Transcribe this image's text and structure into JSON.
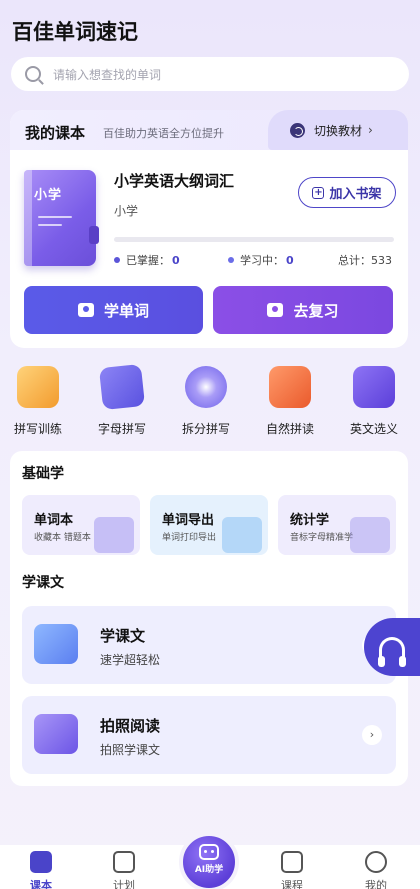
{
  "app": {
    "title": "百佳单词速记"
  },
  "search": {
    "placeholder": "请输入想查找的单词"
  },
  "course": {
    "header_title": "我的课本",
    "header_subtitle": "百佳助力英语全方位提升",
    "switch_label": "切换教材",
    "book_cover_label": "小学",
    "book_title": "小学英语大纲词汇",
    "book_subtitle": "小学",
    "add_shelf_label": "加入书架",
    "progress": 0,
    "mastered_label": "已掌握：",
    "mastered_value": "0",
    "learning_label": "学习中：",
    "learning_value": "0",
    "total_label": "总计：",
    "total_value": "533",
    "learn_button": "学单词",
    "review_button": "去复习"
  },
  "features": [
    {
      "label": "拼写训练",
      "icon": "headphones-icon",
      "color": "#f2a33a"
    },
    {
      "label": "字母拼写",
      "icon": "cards-icon",
      "color": "#6a63e8"
    },
    {
      "label": "拆分拼写",
      "icon": "microphone-icon",
      "color": "#7b6ef0"
    },
    {
      "label": "自然拼读",
      "icon": "radio-icon",
      "color": "#f06a3c"
    },
    {
      "label": "英文选义",
      "icon": "letter-a-icon",
      "color": "#6a4fe0"
    }
  ],
  "basics": {
    "title": "基础学",
    "tiles": [
      {
        "title": "单词本",
        "sub": "收藏本 错题本",
        "bg": "#efecfd"
      },
      {
        "title": "单词导出",
        "sub": "单词打印导出",
        "bg": "#e7f2fd"
      },
      {
        "title": "统计学",
        "sub": "音标字母精准学",
        "bg": "#efecfd"
      }
    ]
  },
  "lessons": {
    "title": "学课文",
    "items": [
      {
        "title": "学课文",
        "sub": "速学超轻松"
      },
      {
        "title": "拍照阅读",
        "sub": "拍照学课文"
      }
    ]
  },
  "tabbar": {
    "items": [
      {
        "label": "课本"
      },
      {
        "label": "计划"
      },
      {
        "label": "课程"
      },
      {
        "label": "我的"
      }
    ],
    "ai_label": "AI助学"
  }
}
